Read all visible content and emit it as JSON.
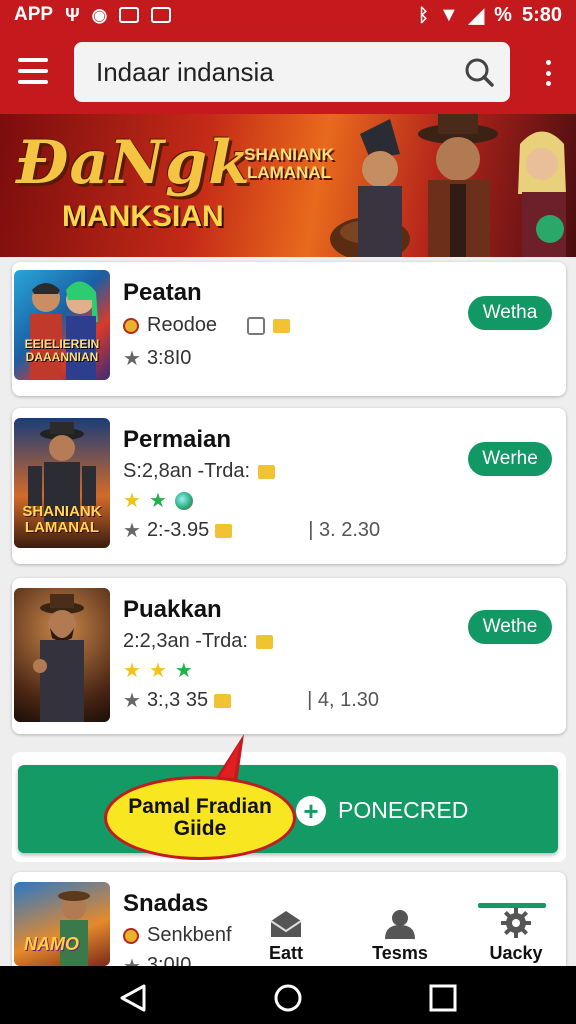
{
  "status_bar": {
    "app_label": "APP",
    "time": "5:80",
    "battery": "%"
  },
  "search": {
    "value": "Indaar indansia"
  },
  "banner": {
    "title": "ĐaNgk",
    "subtitle": "MANKSIAN",
    "logo_text": "SHANIANK\nLAMANAL"
  },
  "apps": [
    {
      "title": "Peatan",
      "meta": "Reodoe",
      "rating": "3:8I0",
      "button": "Wetha",
      "thumb_text": "EEIELIEREIN\nDAAANNIAN"
    },
    {
      "title": "Permaian",
      "meta": "S:2,8an -Trda:",
      "rating": "2:-3.95",
      "extra": "| 3. 2.30",
      "button": "Werhe",
      "thumb_text": "SHANIANK\nLAMANAL"
    },
    {
      "title": "Puakkan",
      "meta": "2:2,3an -Trda:",
      "rating": "3:,3 35",
      "extra": "| 4, 1.30",
      "button": "Wethe"
    },
    {
      "title": "Snadas",
      "meta": "Senkbenf",
      "rating": "3:0I0",
      "thumb_text": "NAMO"
    }
  ],
  "cta": {
    "label": "PONECRED",
    "bubble": "Pamal Fradian\nGiide"
  },
  "bottom_tabs": [
    {
      "label": "Eatt",
      "icon": "mail-icon"
    },
    {
      "label": "Tesms",
      "icon": "person-icon"
    },
    {
      "label": "Uacky",
      "icon": "gear-icon",
      "active": true
    }
  ],
  "colors": {
    "primary_red": "#c4191d",
    "accent_green": "#119865",
    "bubble_yellow": "#f7e620"
  }
}
